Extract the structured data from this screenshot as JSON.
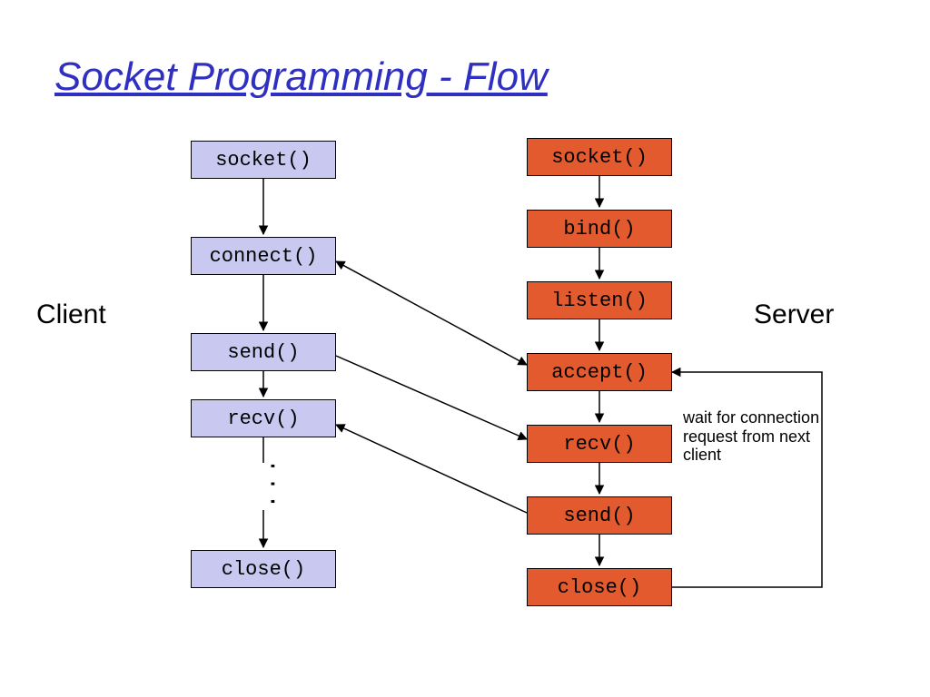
{
  "title": "Socket Programming - Flow",
  "labels": {
    "client": "Client",
    "server": "Server"
  },
  "note": "wait for connection request from next client",
  "ellipsis": "...",
  "client": {
    "socket": "socket()",
    "connect": "connect()",
    "send": "send()",
    "recv": "recv()",
    "close": "close()"
  },
  "server": {
    "socket": "socket()",
    "bind": "bind()",
    "listen": "listen()",
    "accept": "accept()",
    "recv": "recv()",
    "send": "send()",
    "close": "close()"
  },
  "colors": {
    "title": "#3030c0",
    "client_fill": "#c8c8f0",
    "server_fill": "#e25a2e"
  },
  "chart_data": {
    "type": "flow-diagram",
    "nodes": [
      {
        "id": "c_socket",
        "side": "client",
        "label": "socket()"
      },
      {
        "id": "c_connect",
        "side": "client",
        "label": "connect()"
      },
      {
        "id": "c_send",
        "side": "client",
        "label": "send()"
      },
      {
        "id": "c_recv",
        "side": "client",
        "label": "recv()"
      },
      {
        "id": "c_close",
        "side": "client",
        "label": "close()"
      },
      {
        "id": "s_socket",
        "side": "server",
        "label": "socket()"
      },
      {
        "id": "s_bind",
        "side": "server",
        "label": "bind()"
      },
      {
        "id": "s_listen",
        "side": "server",
        "label": "listen()"
      },
      {
        "id": "s_accept",
        "side": "server",
        "label": "accept()"
      },
      {
        "id": "s_recv",
        "side": "server",
        "label": "recv()"
      },
      {
        "id": "s_send",
        "side": "server",
        "label": "send()"
      },
      {
        "id": "s_close",
        "side": "server",
        "label": "close()"
      }
    ],
    "edges": [
      {
        "from": "c_socket",
        "to": "c_connect"
      },
      {
        "from": "c_connect",
        "to": "c_send"
      },
      {
        "from": "c_send",
        "to": "c_recv"
      },
      {
        "from": "c_recv",
        "to": "c_close",
        "note": "ellipsis"
      },
      {
        "from": "s_socket",
        "to": "s_bind"
      },
      {
        "from": "s_bind",
        "to": "s_listen"
      },
      {
        "from": "s_listen",
        "to": "s_accept"
      },
      {
        "from": "s_accept",
        "to": "s_recv"
      },
      {
        "from": "s_recv",
        "to": "s_send"
      },
      {
        "from": "s_send",
        "to": "s_close"
      },
      {
        "from": "c_connect",
        "to": "s_accept",
        "bidirectional": true
      },
      {
        "from": "c_send",
        "to": "s_recv"
      },
      {
        "from": "s_send",
        "to": "c_recv"
      },
      {
        "from": "s_close",
        "to": "s_accept",
        "note": "wait for connection request from next client",
        "loopback": true
      }
    ]
  }
}
